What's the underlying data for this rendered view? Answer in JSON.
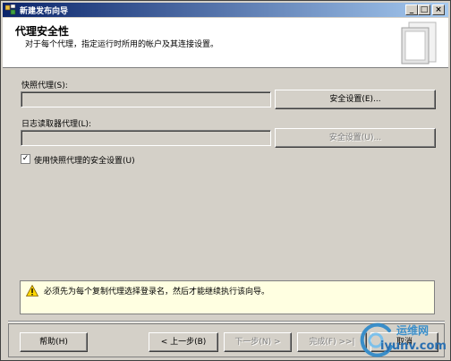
{
  "window": {
    "title": "新建发布向导",
    "minimize": "_",
    "maximize": "□",
    "close": "×"
  },
  "header": {
    "title": "代理安全性",
    "subtitle": "对于每个代理，指定运行时所用的帐户及其连接设置。"
  },
  "snapshot": {
    "label": "快照代理(S):",
    "value": "",
    "button": "安全设置(E)..."
  },
  "logreader": {
    "label": "日志读取器代理(L):",
    "value": "",
    "button": "安全设置(U)..."
  },
  "checkbox": {
    "label": "使用快照代理的安全设置(U)",
    "checked": true,
    "mark": "✓"
  },
  "notice": {
    "icon": "warning-icon",
    "message": "必须先为每个复制代理选择登录名，然后才能继续执行该向导。"
  },
  "footer": {
    "help": "帮助(H)",
    "back": "< 上一步(B)",
    "next": "下一步(N) >",
    "finish": "完成(F) >>|",
    "cancel": "取消"
  },
  "watermark": {
    "title": "运维网",
    "url": "iyunv.com"
  },
  "colors": {
    "title_bar_start": "#0a246a",
    "title_bar_end": "#a6caf0",
    "dialog_face": "#d4d0c8",
    "notice_background": "#ffffe1",
    "watermark": "#3a8ec9"
  }
}
